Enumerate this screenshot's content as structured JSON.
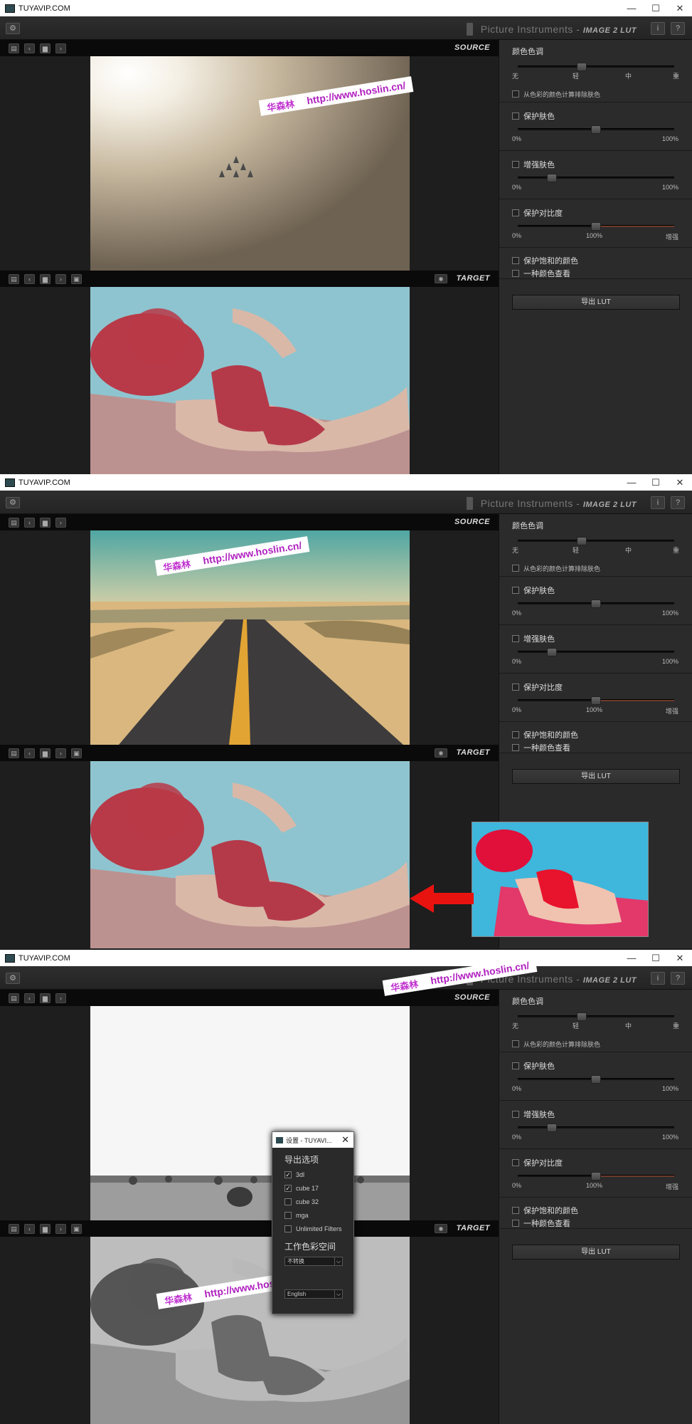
{
  "app": {
    "title": "TUYAVIP.COM",
    "brand_name": "Picture Instruments",
    "brand_dash": "-",
    "brand_product": "IMAGE 2 LUT",
    "info_label": "i",
    "help_label": "?",
    "minimize": "—",
    "maximize": "☐",
    "close": "✕"
  },
  "toolbar": {
    "source_label": "SOURCE",
    "target_label": "TARGET"
  },
  "panel": {
    "color_tone_title": "颜色色调",
    "tone_ticks": [
      "无",
      "轻",
      "中",
      "重"
    ],
    "exclude_skin_label": "从色彩的颜色计算排除肤色",
    "protect_skin_title": "保护肤色",
    "enhance_skin_title": "增强肤色",
    "protect_contrast_title": "保护对比度",
    "pct_0": "0%",
    "pct_100": "100%",
    "enhance_label": "增强",
    "protect_saturated_label": "保护饱和的颜色",
    "one_color_label": "一种颜色查看",
    "export_button": "导出 LUT"
  },
  "slider_levels": {
    "color_tone": 0.41,
    "protect_skin": 0.5,
    "enhance_skin": 0.22,
    "protect_contrast": 0.5
  },
  "watermark": {
    "cn": "华森林",
    "url": "http://www.hoslin.cn/"
  },
  "dialog": {
    "title": "设置 - TUYAVI...",
    "close": "✕",
    "export_options_title": "导出选项",
    "options": [
      {
        "label": "3dl",
        "checked": true
      },
      {
        "label": "cube 17",
        "checked": true
      },
      {
        "label": "cube 32",
        "checked": false
      },
      {
        "label": "mga",
        "checked": false
      },
      {
        "label": "Unlimited Filters",
        "checked": false
      }
    ],
    "workspace_title": "工作色彩空间",
    "workspace_value": "不转换",
    "language_value": "English"
  },
  "colors": {
    "accent_red": "#e8130f",
    "watermark_purple": "#b020c0",
    "bg_dark": "#1e1e1e",
    "panel_bg": "#2b2b2b"
  }
}
